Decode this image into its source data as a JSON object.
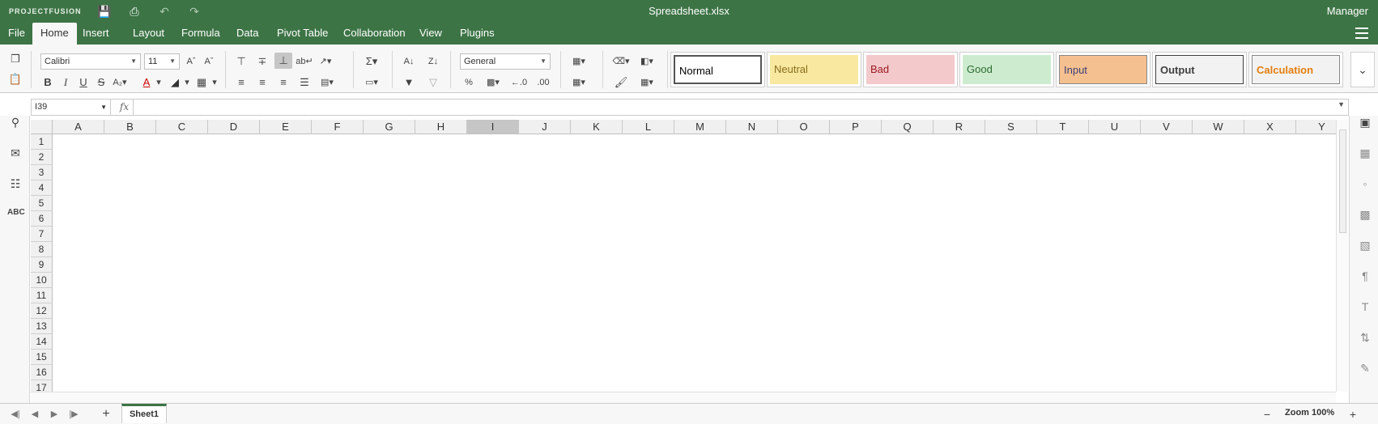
{
  "app": {
    "brand": "PROJECTFUSION",
    "document_title": "Spreadsheet.xlsx",
    "user": "Manager"
  },
  "menu": {
    "items": [
      "File",
      "Home",
      "Insert",
      "Layout",
      "Formula",
      "Data",
      "Pivot Table",
      "Collaboration",
      "View",
      "Plugins"
    ],
    "active": "Home"
  },
  "toolbar": {
    "font_name": "Calibri",
    "font_size": "11",
    "number_format": "General",
    "styles": [
      {
        "label": "Normal",
        "bg": "#ffffff",
        "color": "#000000",
        "border": "#555555",
        "bold": false
      },
      {
        "label": "Neutral",
        "bg": "#f8e8a0",
        "color": "#8a6d1c",
        "border": "#f8e8a0",
        "bold": false
      },
      {
        "label": "Bad",
        "bg": "#f3c9cc",
        "color": "#9c1a1f",
        "border": "#f3c9cc",
        "bold": false
      },
      {
        "label": "Good",
        "bg": "#cdeccf",
        "color": "#2d6a30",
        "border": "#cdeccf",
        "bold": false
      },
      {
        "label": "Input",
        "bg": "#f5c08f",
        "color": "#3f3f76",
        "border": "#888888",
        "bold": false
      },
      {
        "label": "Output",
        "bg": "#f2f2f2",
        "color": "#3f3f3f",
        "border": "#3f3f3f",
        "bold": true
      },
      {
        "label": "Calculation",
        "bg": "#f2f2f2",
        "color": "#e57e0e",
        "border": "#888888",
        "bold": true
      }
    ]
  },
  "formula_bar": {
    "cell_ref": "I39",
    "fx_label": "fx",
    "value": ""
  },
  "grid": {
    "columns": [
      "A",
      "B",
      "C",
      "D",
      "E",
      "F",
      "G",
      "H",
      "I",
      "J",
      "K",
      "L",
      "M",
      "N",
      "O",
      "P",
      "Q",
      "R",
      "S",
      "T",
      "U",
      "V",
      "W",
      "X",
      "Y"
    ],
    "rows": [
      "1",
      "2",
      "3",
      "4",
      "5",
      "6",
      "7",
      "8",
      "9",
      "10",
      "11",
      "12",
      "13",
      "14",
      "15",
      "16",
      "17"
    ],
    "selected_column": "I"
  },
  "sheets": {
    "tabs": [
      "Sheet1"
    ],
    "active": "Sheet1"
  },
  "status": {
    "zoom_label": "Zoom 100%"
  },
  "icons": {
    "left": [
      "search-icon",
      "comment-icon",
      "chat-icon",
      "spellcheck-icon"
    ],
    "right": [
      "cell-settings-icon",
      "table-settings-icon",
      "shape-settings-icon",
      "image-settings-icon",
      "chart-settings-icon",
      "paragraph-settings-icon",
      "text-art-icon",
      "pivot-settings-icon",
      "signature-icon"
    ]
  }
}
